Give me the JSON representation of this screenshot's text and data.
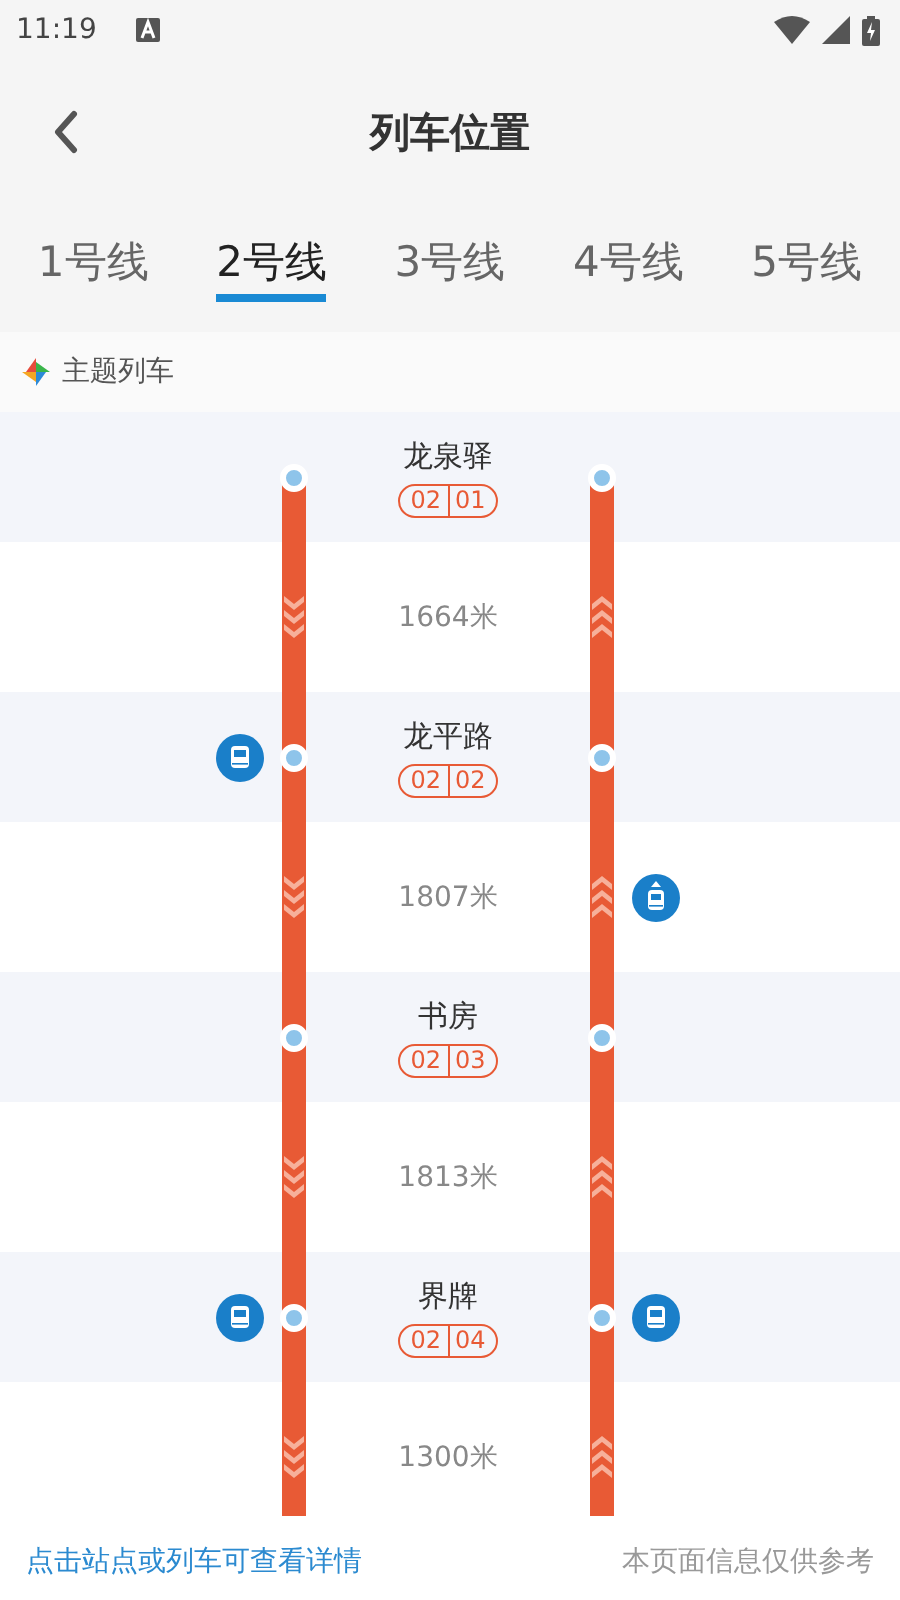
{
  "status_bar": {
    "time": "11:19"
  },
  "header": {
    "title": "列车位置"
  },
  "tabs": [
    {
      "label": "1号线",
      "selected": false
    },
    {
      "label": "2号线",
      "selected": true
    },
    {
      "label": "3号线",
      "selected": false
    },
    {
      "label": "4号线",
      "selected": false
    },
    {
      "label": "5号线",
      "selected": false
    }
  ],
  "theme_train": {
    "label": "主题列车"
  },
  "rows": [
    {
      "kind": "station",
      "name": "龙泉驿",
      "line_code": "02",
      "station_code": "01",
      "left_train": false,
      "right_train": false
    },
    {
      "kind": "segment",
      "distance": "1664米",
      "left_train": false,
      "right_train": false
    },
    {
      "kind": "station",
      "name": "龙平路",
      "line_code": "02",
      "station_code": "02",
      "left_train": true,
      "right_train": false
    },
    {
      "kind": "segment",
      "distance": "1807米",
      "left_train": false,
      "right_train": true
    },
    {
      "kind": "station",
      "name": "书房",
      "line_code": "02",
      "station_code": "03",
      "left_train": false,
      "right_train": false
    },
    {
      "kind": "segment",
      "distance": "1813米",
      "left_train": false,
      "right_train": false
    },
    {
      "kind": "station",
      "name": "界牌",
      "line_code": "02",
      "station_code": "04",
      "left_train": true,
      "right_train": true
    },
    {
      "kind": "segment",
      "distance": "1300米",
      "left_train": false,
      "right_train": false
    }
  ],
  "footer": {
    "hint": "点击站点或列车可查看详情",
    "note": "本页面信息仅供参考"
  }
}
